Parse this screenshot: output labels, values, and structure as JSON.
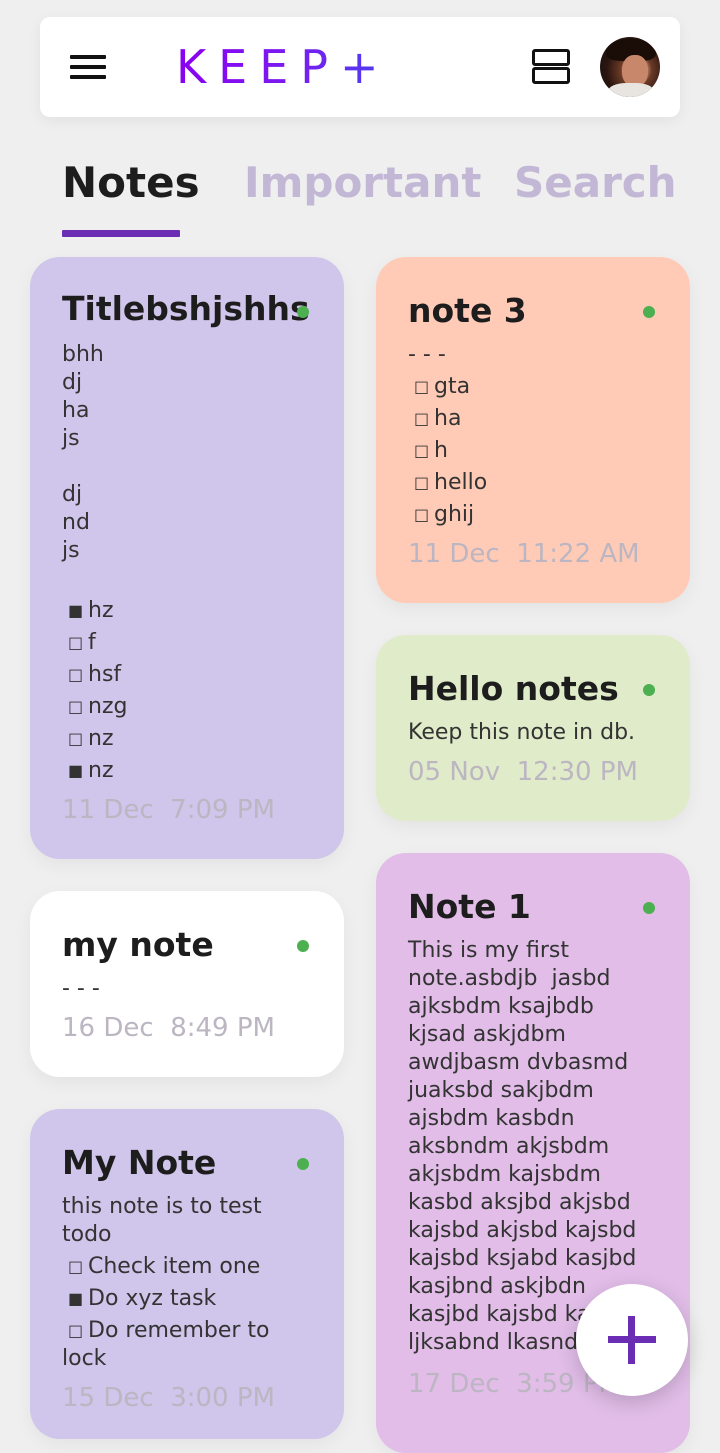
{
  "app": {
    "logo": "KEEP+"
  },
  "tabs": [
    {
      "label": "Notes",
      "active": true
    },
    {
      "label": "Important",
      "active": false
    },
    {
      "label": "Search",
      "active": false
    }
  ],
  "colors": {
    "accent": "#6b2db4",
    "dot": "#4caf50",
    "card_lavender": "#d0c5ea",
    "card_peach": "#ffcbb6",
    "card_green": "#dfebc9",
    "card_white": "#ffffff",
    "card_pink": "#e1bde8"
  },
  "notes": {
    "n1": {
      "title": "Titlebshjshhs",
      "body": "bhh\ndj\nha\njs\n\ndj\nnd\njs",
      "todos": [
        {
          "checked": true,
          "text": "hz"
        },
        {
          "checked": false,
          "text": "f"
        },
        {
          "checked": false,
          "text": "hsf"
        },
        {
          "checked": false,
          "text": "nzg"
        },
        {
          "checked": false,
          "text": "nz"
        },
        {
          "checked": true,
          "text": "nz"
        }
      ],
      "date": "11 Dec  7:09 PM"
    },
    "n2": {
      "title": "my note",
      "body": "- - -",
      "date": "16 Dec  8:49 PM"
    },
    "n3": {
      "title": "My Note",
      "body": "this note is to test\ntodo",
      "todos": [
        {
          "checked": false,
          "text": "Check item one"
        },
        {
          "checked": true,
          "text": "Do xyz task"
        },
        {
          "checked": false,
          "text": "Do remember to"
        }
      ],
      "todo_wrap": "lock",
      "date": "15 Dec  3:00 PM"
    },
    "n4": {
      "title": "note 3",
      "body": "- - -",
      "todos": [
        {
          "checked": false,
          "text": "gta"
        },
        {
          "checked": false,
          "text": "ha"
        },
        {
          "checked": false,
          "text": "h"
        },
        {
          "checked": false,
          "text": "hello"
        },
        {
          "checked": false,
          "text": "ghij"
        }
      ],
      "date": "11 Dec  11:22 AM"
    },
    "n5": {
      "title": "Hello notes",
      "body": "Keep this note in db.",
      "date": "05 Nov  12:30 PM"
    },
    "n6": {
      "title": "Note 1",
      "body": "This is my first\nnote.asbdjb  jasbd\najksbdm ksajbdb\nkjsad askjdbm\nawdjbasm dvbasmd\njuaksbd sakjbdm\najsbdm kasbdn\naksbndm akjsbdm\nakjsbdm kajsbdm\nkasbd aksjbd akjsbd\nkajsbd akjsbd kajsbd\nkajsbd ksjabd kasjbd\nkasjbnd askjbdn\nkasjbd kajsbd kajsbd\nljksabnd lkasndkl",
      "date": "17 Dec  3:59 PM"
    }
  },
  "icons": {
    "menu": "menu-icon",
    "view_toggle": "view-toggle-icon",
    "add": "plus-icon",
    "unchecked": "□",
    "checked": "■"
  }
}
